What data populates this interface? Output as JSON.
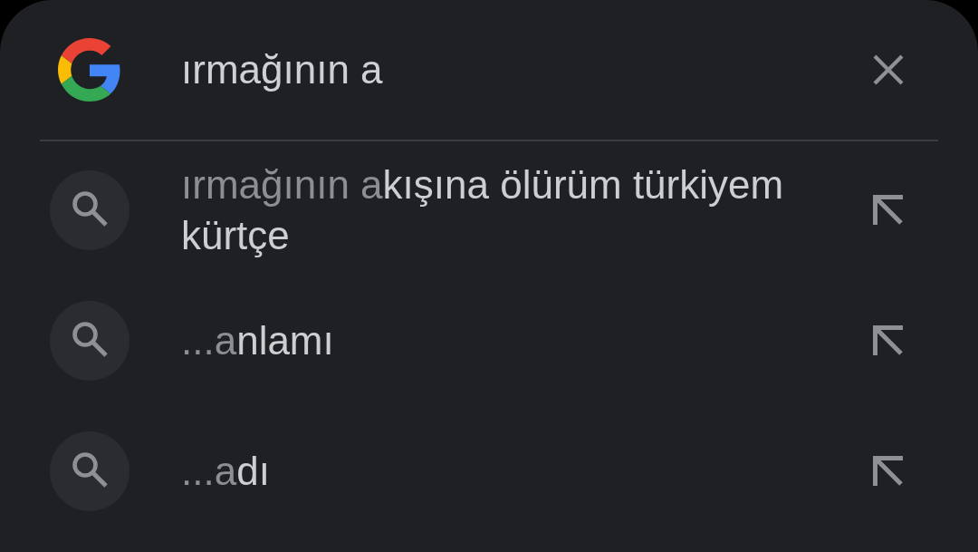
{
  "search_bar": {
    "query": "ırmağının a"
  },
  "suggestions": [
    {
      "matched": "ırmağının a",
      "completion": "kışına ölürüm türkiyem kürtçe"
    },
    {
      "matched": "...a",
      "completion": "nlamı"
    },
    {
      "matched": "...a",
      "completion": "dı"
    }
  ]
}
